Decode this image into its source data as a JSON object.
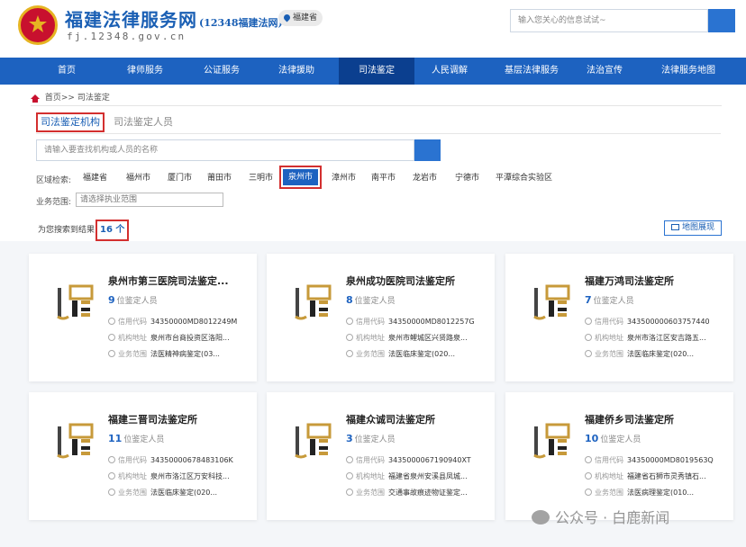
{
  "header": {
    "title": "福建法律服务网",
    "title_sub": "(12348福建法网)",
    "domain": "fj.12348.gov.cn",
    "region": "福建省",
    "search_placeholder": "输入您关心的信息试试~"
  },
  "nav": [
    "首页",
    "律师服务",
    "公证服务",
    "法律援助",
    "司法鉴定",
    "人民调解",
    "基层法律服务",
    "法治宣传",
    "法律服务地图"
  ],
  "nav_active": "司法鉴定",
  "breadcrumb": {
    "home": "首页>>",
    "current": "司法鉴定"
  },
  "tabs": {
    "active": "司法鉴定机构",
    "inactive": "司法鉴定人员"
  },
  "org_search_placeholder": "请输入要查找机构或人员的名称",
  "region_label": "区域检索:",
  "cities": [
    "福建省",
    "福州市",
    "厦门市",
    "莆田市",
    "三明市",
    "泉州市",
    "漳州市",
    "南平市",
    "龙岩市",
    "宁德市",
    "平潭综合实验区"
  ],
  "selected_city": "泉州市",
  "scope_label": "业务范围:",
  "scope_placeholder": "请选择执业范围",
  "result": {
    "label": "为您搜索到结果",
    "count": "16 个"
  },
  "map_button": "地图展现",
  "field_labels": {
    "count_suffix": "位鉴定人员",
    "credit": "信用代码",
    "address": "机构地址",
    "scope": "业务范围"
  },
  "cards": [
    {
      "name": "泉州市第三医院司法鉴定...",
      "count": "9",
      "credit": "34350000MD8012249M",
      "address": "泉州市台商投资区洛阳...",
      "scope": "法医精神病鉴定(03..."
    },
    {
      "name": "泉州成功医院司法鉴定所",
      "count": "8",
      "credit": "34350000MD8012257G",
      "address": "泉州市鲤城区兴贤路泉...",
      "scope": "法医临床鉴定(020..."
    },
    {
      "name": "福建万鸿司法鉴定所",
      "count": "7",
      "credit": "343500000603757440",
      "address": "泉州市洛江区安吉路五...",
      "scope": "法医临床鉴定(020..."
    },
    {
      "name": "福建三晋司法鉴定所",
      "count": "11",
      "credit": "34350000678483106K",
      "address": "泉州市洛江区万安科技...",
      "scope": "法医临床鉴定(020..."
    },
    {
      "name": "福建众诚司法鉴定所",
      "count": "3",
      "credit": "3435000067190940XT",
      "address": "福建省泉州安溪县凤城...",
      "scope": "交通事故痕迹物证鉴定..."
    },
    {
      "name": "福建侨乡司法鉴定所",
      "count": "10",
      "credit": "34350000MD8019563Q",
      "address": "福建省石狮市灵秀镇石...",
      "scope": "法医病理鉴定(010..."
    }
  ],
  "watermark": "公众号 · 白鹿新闻",
  "colors": {
    "brand_blue": "#1d62c0",
    "nav_active": "#0b3f8f",
    "highlight_red": "#d32f2f",
    "emblem_red": "#c8102e"
  }
}
